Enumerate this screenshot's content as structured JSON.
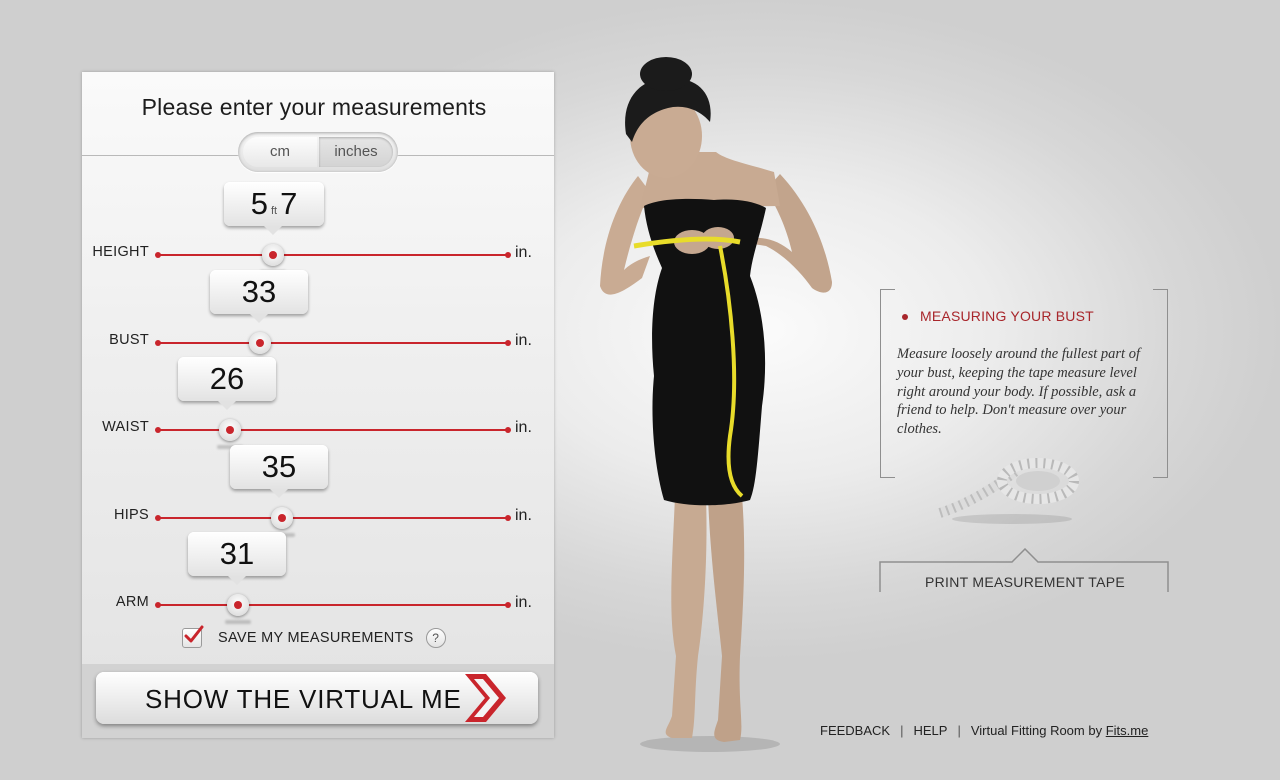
{
  "panel": {
    "title": "Please enter your measurements",
    "units": {
      "cm": "cm",
      "inches": "inches",
      "selected": "inches"
    },
    "rows": [
      {
        "label": "HEIGHT",
        "value_ft": "5",
        "ft_label": "ft",
        "value_in": "7",
        "unit": "in."
      },
      {
        "label": "BUST",
        "value": "33",
        "unit": "in."
      },
      {
        "label": "WAIST",
        "value": "26",
        "unit": "in."
      },
      {
        "label": "HIPS",
        "value": "35",
        "unit": "in."
      },
      {
        "label": "ARM",
        "value": "31",
        "unit": "in."
      }
    ],
    "save_label": "SAVE MY MEASUREMENTS",
    "save_checked": true,
    "help_symbol": "?",
    "cta_label": "SHOW THE VIRTUAL ME"
  },
  "info": {
    "heading": "MEASURING YOUR BUST",
    "text": "Measure loosely around the fullest part of your bust, keeping the tape measure level right around your body. If possible, ask a friend to help. Don't measure over your clothes.",
    "print_label": "PRINT MEASUREMENT TAPE"
  },
  "footer": {
    "feedback": "FEEDBACK",
    "help": "HELP",
    "credit": "Virtual Fitting Room by",
    "credit_link": "Fits.me",
    "separator": "|"
  },
  "colors": {
    "accent": "#c9252c",
    "heading": "#a8262b",
    "dress": "#111111",
    "tape": "#e8dc2a"
  },
  "icons": {
    "check": "checkmark-icon",
    "arrow": "chevron-right-icon",
    "help": "question-icon",
    "tape": "measuring-tape-icon"
  }
}
